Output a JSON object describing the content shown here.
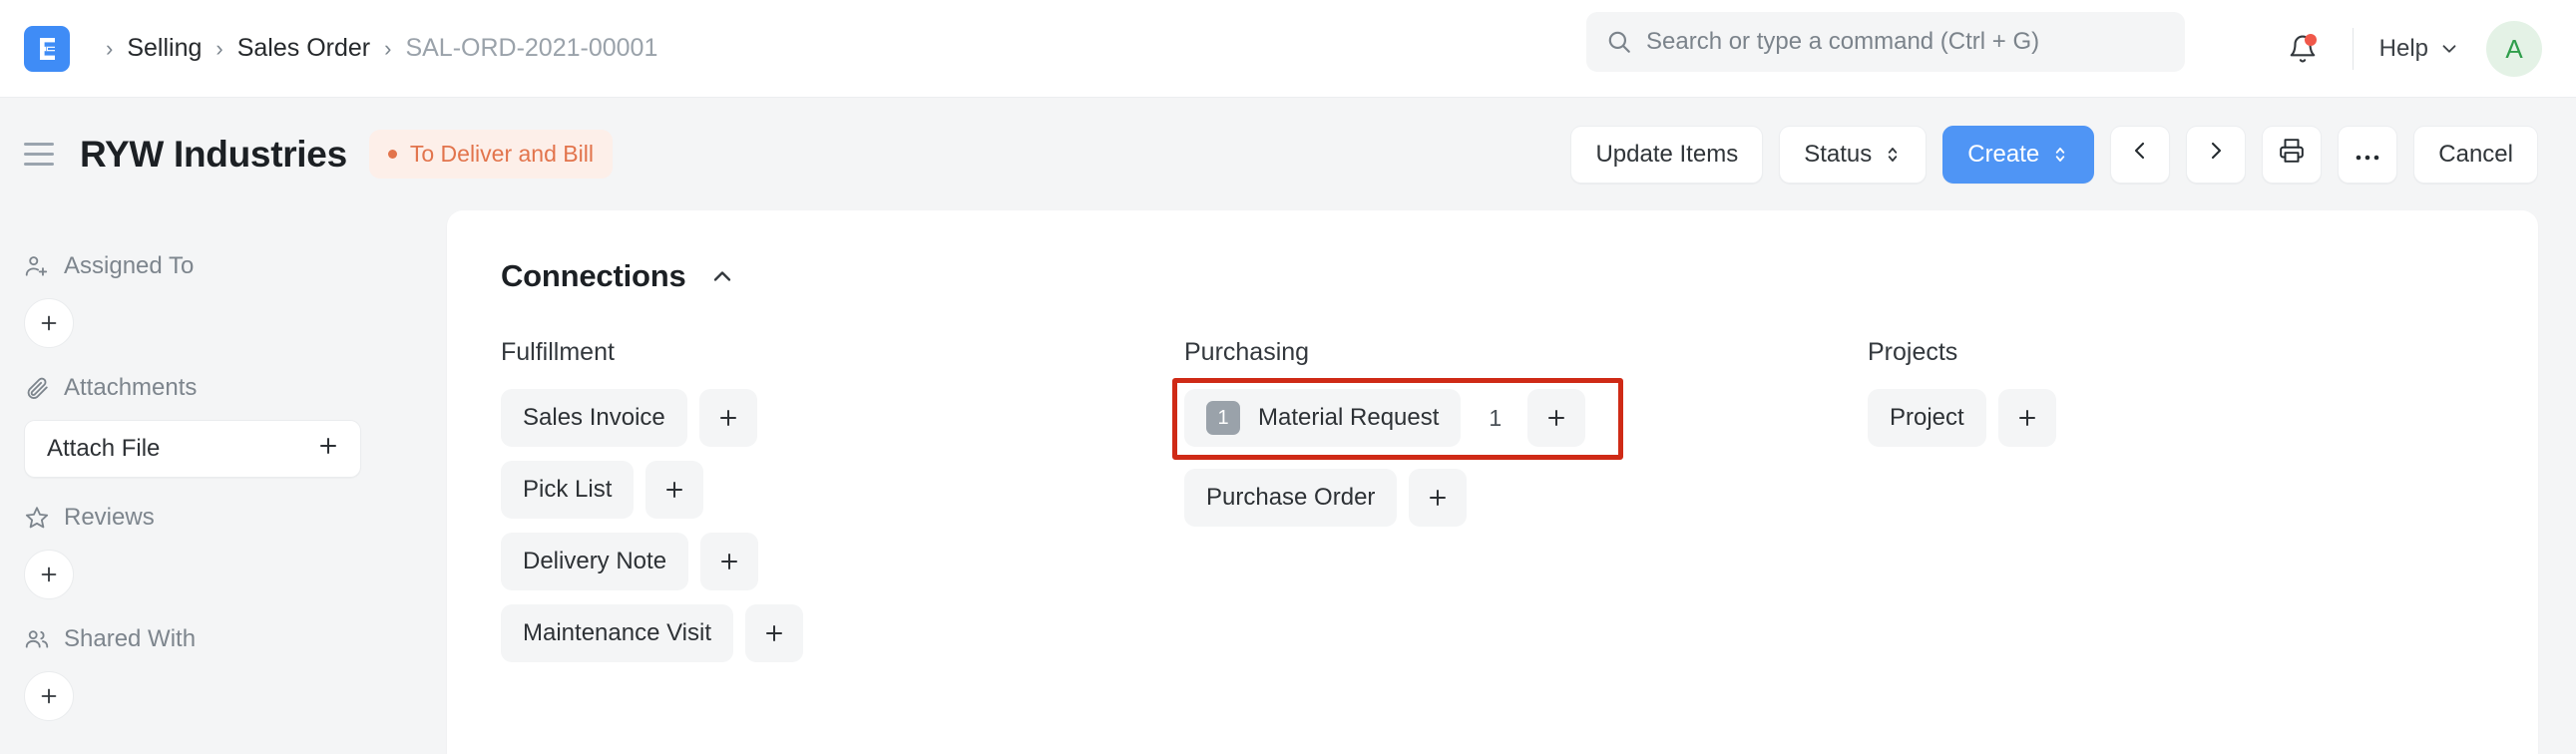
{
  "navbar": {
    "logo_icon": "erpnext-logo-icon",
    "breadcrumb": {
      "separator": "›",
      "items": [
        {
          "label": "Selling",
          "current": false
        },
        {
          "label": "Sales Order",
          "current": false
        },
        {
          "label": "SAL-ORD-2021-00001",
          "current": true
        }
      ]
    },
    "search": {
      "icon": "search-icon",
      "placeholder": "Search or type a command (Ctrl + G)",
      "value": ""
    },
    "notifications": {
      "icon": "bell-icon",
      "has_unread": true,
      "dot_color": "#f0584a"
    },
    "help": {
      "label": "Help",
      "icon": "chevron-down-icon"
    },
    "avatar": {
      "initial": "A",
      "bg": "#e4f2e6",
      "color": "#2f9e4b"
    }
  },
  "page_head": {
    "menu_icon": "hamburger-menu-icon",
    "title": "RYW Industries",
    "status": {
      "label": "To Deliver and Bill",
      "color": "#e2744c",
      "bg": "#fdefe9"
    },
    "actions": {
      "update_items": "Update Items",
      "status": "Status",
      "create": "Create",
      "cancel": "Cancel",
      "select_glyph": "⇅",
      "prev_icon": "chevron-left-icon",
      "next_icon": "chevron-right-icon",
      "print_icon": "printer-icon",
      "more_icon": "ellipsis-icon"
    }
  },
  "sidebar": {
    "groups": [
      {
        "title": "Assigned To",
        "icon": "user-plus-icon",
        "control": "plus-circle"
      },
      {
        "title": "Attachments",
        "icon": "paperclip-icon",
        "control": "attach-button",
        "button_label": "Attach File"
      },
      {
        "title": "Reviews",
        "icon": "star-icon",
        "control": "plus-circle"
      },
      {
        "title": "Shared With",
        "icon": "users-icon",
        "control": "plus-circle"
      }
    ]
  },
  "connections": {
    "title": "Connections",
    "collapse_icon": "chevron-up-icon",
    "columns": [
      {
        "title": "Fulfillment",
        "links": [
          {
            "label": "Sales Invoice",
            "badge": null,
            "count": null
          },
          {
            "label": "Pick List",
            "badge": null,
            "count": null
          },
          {
            "label": "Delivery Note",
            "badge": null,
            "count": null
          },
          {
            "label": "Maintenance Visit",
            "badge": null,
            "count": null
          }
        ]
      },
      {
        "title": "Purchasing",
        "links": [
          {
            "label": "Material Request",
            "badge": "1",
            "count": "1",
            "highlighted": true
          },
          {
            "label": "Purchase Order",
            "badge": null,
            "count": null
          }
        ]
      },
      {
        "title": "Projects",
        "links": [
          {
            "label": "Project",
            "badge": null,
            "count": null
          }
        ]
      }
    ]
  },
  "annotation": {
    "color": "#cf2a16",
    "target": "material-request-connection-row"
  }
}
